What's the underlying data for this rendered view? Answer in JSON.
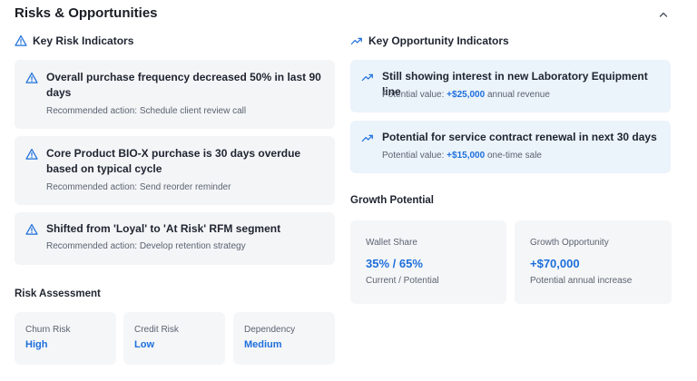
{
  "page": {
    "title": "Risks & Opportunities"
  },
  "colors": {
    "accent": "#1d6fdc",
    "risk_card_bg": "#f3f5f7",
    "opportunity_card_bg": "#ebf3fb"
  },
  "icons": {
    "risk": "warning-triangle-icon",
    "opportunity": "trending-up-icon",
    "collapse": "chevron-up-icon"
  },
  "risks": {
    "title": "Key Risk Indicators",
    "items": [
      {
        "title": "Overall purchase frequency decreased 50% in last 90 days",
        "action": "Recommended action: Schedule client review call"
      },
      {
        "title": "Core Product BIO-X purchase is 30 days overdue based on typical cycle",
        "action": "Recommended action: Send reorder reminder"
      },
      {
        "title": "Shifted from 'Loyal' to 'At Risk' RFM segment",
        "action": "Recommended action: Develop retention strategy"
      }
    ]
  },
  "opportunities": {
    "title": "Key Opportunity Indicators",
    "items": [
      {
        "title": "Still showing interest in new Laboratory Equipment line",
        "value_prefix": "Potential value:",
        "value": "+$25,000",
        "value_suffix": "annual revenue"
      },
      {
        "title": "Potential for service contract renewal in next 30 days",
        "value_prefix": "Potential value:",
        "value": "+$15,000",
        "value_suffix": "one-time sale"
      }
    ]
  },
  "assessment": {
    "title": "Risk Assessment",
    "tiles": [
      {
        "label": "Churn Risk",
        "value": "High"
      },
      {
        "label": "Credit Risk",
        "value": "Low"
      },
      {
        "label": "Dependency",
        "value": "Medium"
      }
    ]
  },
  "growth": {
    "title": "Growth Potential",
    "tiles": [
      {
        "label": "Wallet Share",
        "value": "35% / 65%",
        "note": "Current / Potential"
      },
      {
        "label": "Growth Opportunity",
        "value": "+$70,000",
        "note": "Potential annual increase"
      }
    ]
  }
}
